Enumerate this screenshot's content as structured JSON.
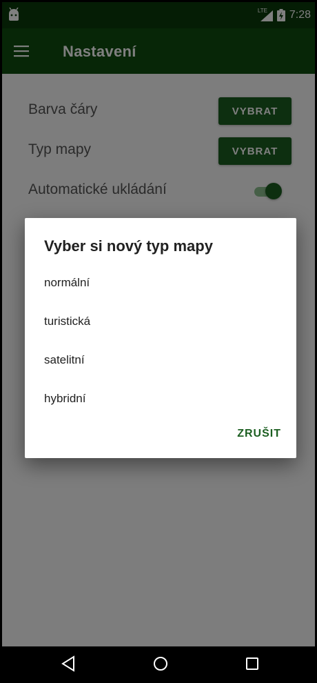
{
  "status_bar": {
    "time": "7:28",
    "network": "LTE",
    "icons": [
      "android-debug-icon",
      "lte-signal-icon",
      "battery-charging-icon"
    ]
  },
  "app_bar": {
    "title": "Nastavení",
    "menu_icon": "hamburger-menu-icon"
  },
  "settings": {
    "line_color_label": "Barva čáry",
    "line_color_button": "VYBRAT",
    "map_type_label": "Typ mapy",
    "map_type_button": "VYBRAT",
    "autosave_label": "Automatické ukládání",
    "autosave_enabled": true
  },
  "dialog": {
    "title": "Vyber si nový typ mapy",
    "options": [
      "normální",
      "turistická",
      "satelitní",
      "hybridní"
    ],
    "cancel_label": "ZRUŠIT"
  },
  "nav_bar": {
    "icons": [
      "back-icon",
      "home-icon",
      "recents-icon"
    ]
  },
  "colors": {
    "primary_dark": "#0b3a0b",
    "primary": "#0f4d0f",
    "accent": "#1b5e20"
  }
}
